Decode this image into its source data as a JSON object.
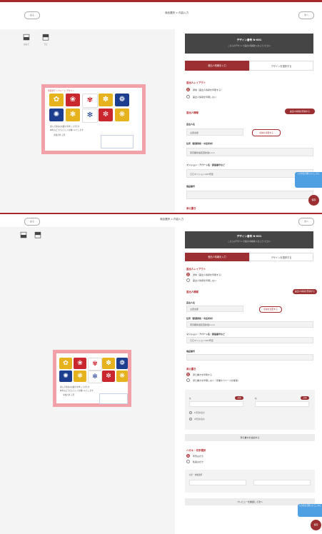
{
  "colors": {
    "brand": "#a5282b",
    "card_border": "#f2a1a8",
    "help": "#4f9fe3",
    "banner": "#454545"
  },
  "topbar": {
    "back_label": "戻る",
    "steps": "商品選択 > 内容入力",
    "next_label": "次へ"
  },
  "left": {
    "front_label": "おもて",
    "back_label": "うら",
    "card_title": "年賀状テンプレート デザイン",
    "card_text_line1": "謹んで新春のお慶びを申し上げます",
    "card_text_line2": "本年もどうぞよろしくお願いいたします",
    "card_text_line3": "令和六年 元旦"
  },
  "right": {
    "banner_title": "デザイン番号 N-001",
    "banner_sub": "こちらのデザインで差出人情報を入力してください",
    "tab_active": "差出人情報を入力",
    "tab_inactive": "デザインを選択する",
    "layout_section": "差出人レイアウト",
    "layout_option1": "通常（差出人情報を印刷する）",
    "layout_option2": "差出人情報を印刷しない",
    "sender_section": "差出人情報",
    "sender_button": "差出人情報を登録する",
    "name_label": "差出人名",
    "name_value": "山田太郎",
    "change_button": "名前を変更する",
    "address_label": "住所（都道府県・市区町村）",
    "address_value": "東京都新宿区西新宿1-1-1",
    "building_label": "マンション・アパート名・部屋番号など",
    "building_value": "〇〇マンション101号室",
    "phone_label": "電話番号",
    "phone_value": "",
    "message_section": "添え書き",
    "message_option1": "添え書きを印刷する",
    "message_option2": "添え書きを印刷しない（手書きスペースを確保）",
    "col_left_label": "左",
    "col_right_label": "右",
    "col_badge": "必須",
    "col_value": "",
    "line_option1": "1行目を表示",
    "line_option2": "2行目を表示",
    "add_bar": "添え書きを追加する",
    "postcard_section": "ハガキ・切手選択",
    "postcard_option1": "年賀はがき",
    "postcard_option2": "私製はがき",
    "postcard_field_label": "切手・枚数選択",
    "preview_bar": "プレビューを確認して次へ",
    "help_tab": "入力方法で困ったらこちら",
    "fab_label": "保存"
  }
}
